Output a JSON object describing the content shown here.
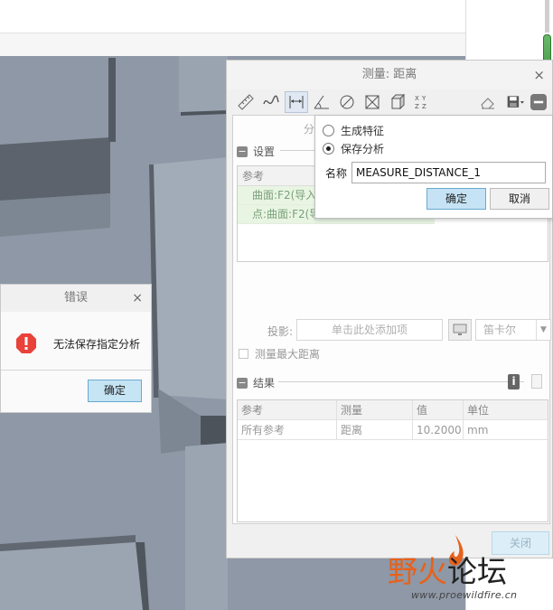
{
  "measure_dialog": {
    "title": "测量: 距离",
    "close_glyph": "×",
    "section_tab_partial": "分",
    "settings": {
      "header": "设置",
      "ref_header": "参考",
      "ref_rows": [
        "曲面:F2(导入特",
        "点:曲面:F2(导入"
      ],
      "projection_label": "投影:",
      "projection_placeholder": "单击此处添加项",
      "coord_system": "笛卡尔",
      "measure_max_label": "测量最大距离"
    },
    "results": {
      "header": "结果",
      "columns": [
        "参考",
        "测量",
        "值",
        "单位"
      ],
      "rows": [
        {
          "ref": "所有参考",
          "measure": "距离",
          "value": "10.2000",
          "unit": "mm"
        }
      ]
    },
    "close_button": "关闭"
  },
  "save_popup": {
    "option_feature": "生成特征",
    "option_save": "保存分析",
    "selected": "save",
    "name_label": "名称",
    "name_value": "MEASURE_DISTANCE_1",
    "ok_label": "确定",
    "cancel_label": "取消"
  },
  "error_dialog": {
    "title": "错误",
    "close_glyph": "×",
    "message": "无法保存指定分析",
    "ok_label": "确定"
  },
  "watermark": {
    "part1": "野火",
    "part2": "论坛",
    "url": "www.proewildfire.cn"
  },
  "colors": {
    "accent": "#c5e3f4",
    "error_red": "#e8423a",
    "viewport": "#8e98a6",
    "watermark_orange": "#e8611a"
  }
}
